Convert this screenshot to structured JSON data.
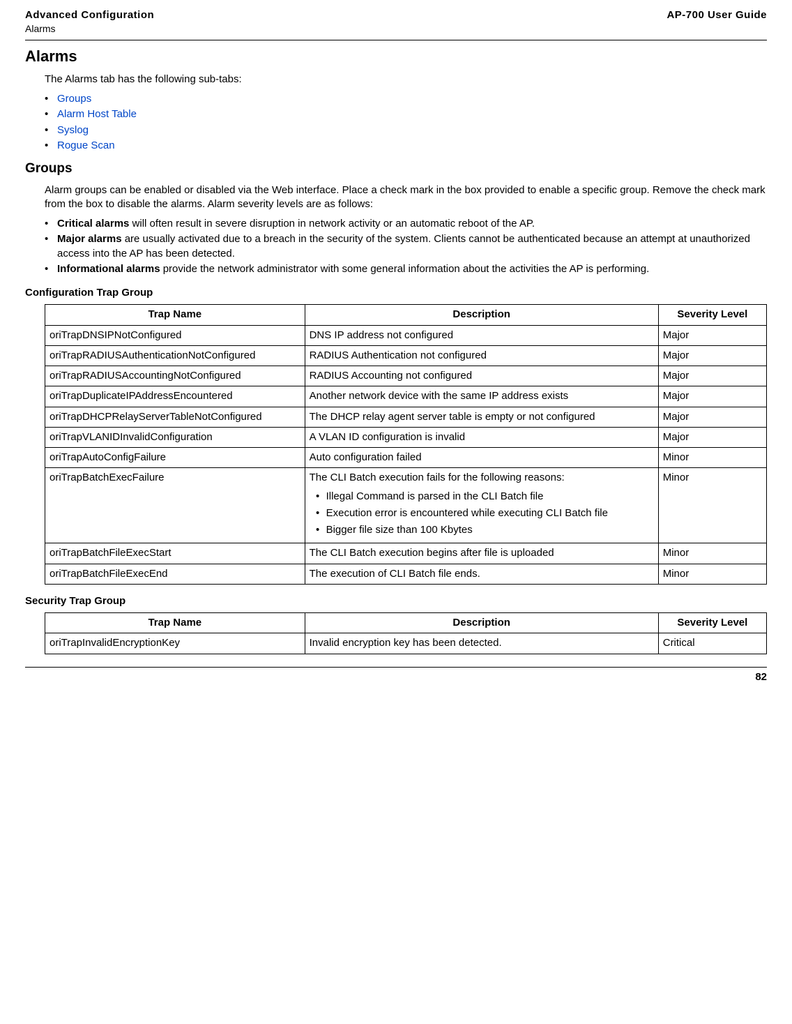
{
  "header": {
    "left_top": "Advanced Configuration",
    "left_sub": "Alarms",
    "right": "AP-700 User Guide"
  },
  "h1": "Alarms",
  "intro": "The Alarms tab has the following sub-tabs:",
  "links": [
    "Groups",
    "Alarm Host Table",
    "Syslog",
    "Rogue Scan"
  ],
  "groups": {
    "title": "Groups",
    "para": "Alarm groups can be enabled or disabled via the Web interface. Place a check mark in the box provided to enable a specific group. Remove the check mark from the box to disable the alarms. Alarm severity levels are as follows:",
    "items": [
      {
        "bold": "Critical alarms",
        "rest": " will often result in severe disruption in network activity or an automatic reboot of the AP."
      },
      {
        "bold": "Major alarms",
        "rest": " are usually activated due to a breach in the security of the system. Clients cannot be authenticated because an attempt at unauthorized access into the AP has been detected."
      },
      {
        "bold": "Informational alarms",
        "rest": " provide the network administrator with some general information about the activities the AP is performing."
      }
    ]
  },
  "tableHeaders": {
    "name": "Trap Name",
    "desc": "Description",
    "sev": "Severity Level"
  },
  "configGroup": {
    "title": "Configuration Trap Group",
    "rows": [
      {
        "name": "oriTrapDNSIPNotConfigured",
        "desc": "DNS IP address not configured",
        "sev": "Major"
      },
      {
        "name": "oriTrapRADIUSAuthenticationNotConfigured",
        "desc": "RADIUS Authentication not configured",
        "sev": "Major"
      },
      {
        "name": "oriTrapRADIUSAccountingNotConfigured",
        "desc": "RADIUS Accounting not configured",
        "sev": "Major"
      },
      {
        "name": "oriTrapDuplicateIPAddressEncountered",
        "desc": "Another network device with the same IP address exists",
        "sev": "Major"
      },
      {
        "name": "oriTrapDHCPRelayServerTableNotConfigured",
        "desc": "The DHCP relay agent server table is empty or not configured",
        "sev": "Major"
      },
      {
        "name": "oriTrapVLANIDInvalidConfiguration",
        "desc": "A VLAN ID configuration is invalid",
        "sev": "Major"
      },
      {
        "name": "oriTrapAutoConfigFailure",
        "desc": "Auto configuration failed",
        "sev": "Minor"
      },
      {
        "name": "oriTrapBatchExecFailure",
        "desc_lead": "The CLI Batch execution fails for the following reasons:",
        "desc_items": [
          "Illegal Command is parsed in the CLI Batch file",
          "Execution error is encountered while executing CLI Batch file",
          "Bigger file size than 100 Kbytes"
        ],
        "sev": "Minor"
      },
      {
        "name": "oriTrapBatchFileExecStart",
        "desc": "The CLI Batch execution begins after file is uploaded",
        "sev": "Minor"
      },
      {
        "name": "oriTrapBatchFileExecEnd",
        "desc": "The execution of CLI Batch file ends.",
        "sev": "Minor"
      }
    ]
  },
  "securityGroup": {
    "title": "Security Trap Group",
    "rows": [
      {
        "name": "oriTrapInvalidEncryptionKey",
        "desc": "Invalid encryption key has been detected.",
        "sev": "Critical"
      }
    ]
  },
  "pageNumber": "82"
}
